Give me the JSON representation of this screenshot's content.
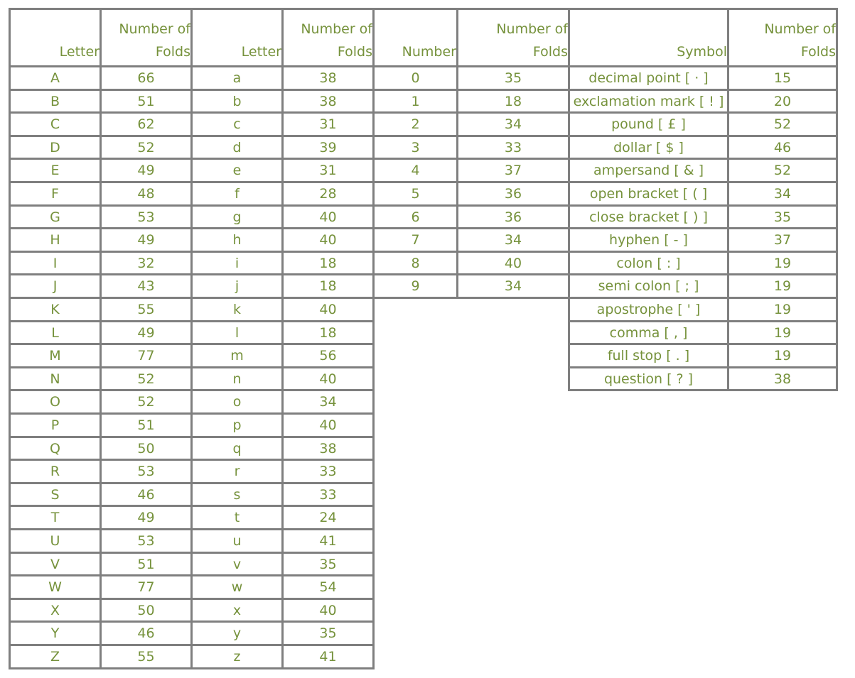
{
  "headers": {
    "letter": "Letter",
    "number": "Number",
    "symbol": "Symbol",
    "folds_line1": "Number of",
    "folds_line2": "Folds"
  },
  "uppercase": [
    {
      "char": "A",
      "folds": "66"
    },
    {
      "char": "B",
      "folds": "51"
    },
    {
      "char": "C",
      "folds": "62"
    },
    {
      "char": "D",
      "folds": "52"
    },
    {
      "char": "E",
      "folds": "49"
    },
    {
      "char": "F",
      "folds": "48"
    },
    {
      "char": "G",
      "folds": "53"
    },
    {
      "char": "H",
      "folds": "49"
    },
    {
      "char": "I",
      "folds": "32"
    },
    {
      "char": "J",
      "folds": "43"
    },
    {
      "char": "K",
      "folds": "55"
    },
    {
      "char": "L",
      "folds": "49"
    },
    {
      "char": "M",
      "folds": "77"
    },
    {
      "char": "N",
      "folds": "52"
    },
    {
      "char": "O",
      "folds": "52"
    },
    {
      "char": "P",
      "folds": "51"
    },
    {
      "char": "Q",
      "folds": "50"
    },
    {
      "char": "R",
      "folds": "53"
    },
    {
      "char": "S",
      "folds": "46"
    },
    {
      "char": "T",
      "folds": "49"
    },
    {
      "char": "U",
      "folds": "53"
    },
    {
      "char": "V",
      "folds": "51"
    },
    {
      "char": "W",
      "folds": "77"
    },
    {
      "char": "X",
      "folds": "50"
    },
    {
      "char": "Y",
      "folds": "46"
    },
    {
      "char": "Z",
      "folds": "55"
    }
  ],
  "lowercase": [
    {
      "char": "a",
      "folds": "38"
    },
    {
      "char": "b",
      "folds": "38"
    },
    {
      "char": "c",
      "folds": "31"
    },
    {
      "char": "d",
      "folds": "39"
    },
    {
      "char": "e",
      "folds": "31"
    },
    {
      "char": "f",
      "folds": "28"
    },
    {
      "char": "g",
      "folds": "40"
    },
    {
      "char": "h",
      "folds": "40"
    },
    {
      "char": "i",
      "folds": "18"
    },
    {
      "char": "j",
      "folds": "18"
    },
    {
      "char": "k",
      "folds": "40"
    },
    {
      "char": "l",
      "folds": "18"
    },
    {
      "char": "m",
      "folds": "56"
    },
    {
      "char": "n",
      "folds": "40"
    },
    {
      "char": "o",
      "folds": "34"
    },
    {
      "char": "p",
      "folds": "40"
    },
    {
      "char": "q",
      "folds": "38"
    },
    {
      "char": "r",
      "folds": "33"
    },
    {
      "char": "s",
      "folds": "33"
    },
    {
      "char": "t",
      "folds": "24"
    },
    {
      "char": "u",
      "folds": "41"
    },
    {
      "char": "v",
      "folds": "35"
    },
    {
      "char": "w",
      "folds": "54"
    },
    {
      "char": "x",
      "folds": "40"
    },
    {
      "char": "y",
      "folds": "35"
    },
    {
      "char": "z",
      "folds": "41"
    }
  ],
  "numbers": [
    {
      "char": "0",
      "folds": "35"
    },
    {
      "char": "1",
      "folds": "18"
    },
    {
      "char": "2",
      "folds": "34"
    },
    {
      "char": "3",
      "folds": "33"
    },
    {
      "char": "4",
      "folds": "37"
    },
    {
      "char": "5",
      "folds": "36"
    },
    {
      "char": "6",
      "folds": "36"
    },
    {
      "char": "7",
      "folds": "34"
    },
    {
      "char": "8",
      "folds": "40"
    },
    {
      "char": "9",
      "folds": "34"
    }
  ],
  "symbols": [
    {
      "char": "decimal point [ · ]",
      "folds": "15"
    },
    {
      "char": "exclamation mark [ ! ]",
      "folds": "20"
    },
    {
      "char": "pound [ £ ]",
      "folds": "52"
    },
    {
      "char": "dollar [ $ ]",
      "folds": "46"
    },
    {
      "char": "ampersand [ & ]",
      "folds": "52"
    },
    {
      "char": "open bracket [ ( ]",
      "folds": "34"
    },
    {
      "char": "close bracket [ ) ]",
      "folds": "35"
    },
    {
      "char": "hyphen [ - ]",
      "folds": "37"
    },
    {
      "char": "colon [ : ]",
      "folds": "19"
    },
    {
      "char": "semi colon [ ; ]",
      "folds": "19"
    },
    {
      "char": "apostrophe [ ' ]",
      "folds": "19"
    },
    {
      "char": "comma [ , ]",
      "folds": "19"
    },
    {
      "char": "full stop [ . ]",
      "folds": "19"
    },
    {
      "char": "question [ ? ]",
      "folds": "38"
    }
  ]
}
